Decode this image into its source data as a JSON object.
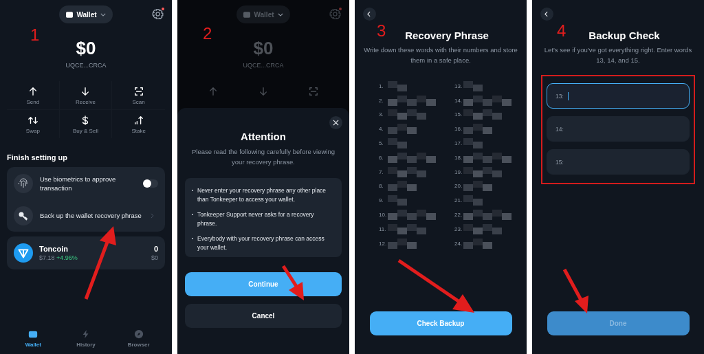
{
  "screen_1": {
    "step": "1",
    "wallet_switcher": {
      "label": "Wallet"
    },
    "settings": {
      "notification": true
    },
    "balance": "$0",
    "address": "UQCE...CRCA",
    "actions": [
      {
        "kind": "send",
        "label": "Send"
      },
      {
        "kind": "receive",
        "label": "Receive"
      },
      {
        "kind": "scan",
        "label": "Scan"
      },
      {
        "kind": "swap",
        "label": "Swap"
      },
      {
        "kind": "buy",
        "label": "Buy & Sell"
      },
      {
        "kind": "stake",
        "label": "Stake"
      }
    ],
    "section_title": "Finish setting up",
    "setup_items": [
      {
        "kind": "toggle",
        "label": "Use biometrics to approve transaction",
        "on": false
      },
      {
        "kind": "link",
        "label": "Back up the wallet recovery phrase"
      }
    ],
    "token": {
      "name": "Toncoin",
      "price": "$7.18",
      "change": "+4.96%",
      "amount": "0",
      "value": "$0"
    },
    "tabs": [
      {
        "kind": "wallet",
        "label": "Wallet",
        "selected": true
      },
      {
        "kind": "history",
        "label": "History",
        "selected": false
      },
      {
        "kind": "browser",
        "label": "Browser",
        "selected": false
      }
    ]
  },
  "screen_2": {
    "step": "2",
    "background": {
      "wallet_switcher": "Wallet",
      "settings": {
        "notification": true
      },
      "balance": "$0",
      "address": "UQCE...CRCA",
      "actions": [
        {
          "kind": "send"
        },
        {
          "kind": "receive"
        },
        {
          "kind": "scan"
        }
      ]
    },
    "dialog": {
      "title": "Attention",
      "subtitle": "Please read the following carefully before viewing your recovery phrase.",
      "bullets": [
        "Never enter your recovery phrase any other place than Tonkeeper to access your wallet.",
        "Tonkeeper Support never asks for a recovery phrase.",
        "Everybody with your recovery phrase can access your wallet."
      ],
      "buttons": [
        {
          "kind": "primary",
          "label": "Continue"
        },
        {
          "kind": "secondary",
          "label": "Cancel"
        }
      ]
    }
  },
  "screen_3": {
    "step": "3",
    "title": "Recovery Phrase",
    "subtitle": "Write down these words with their numbers and store them in a safe place.",
    "numbers": [
      "1.",
      "2.",
      "3.",
      "4.",
      "5.",
      "6.",
      "7.",
      "8.",
      "9.",
      "10.",
      "11.",
      "12.",
      "13.",
      "14.",
      "15.",
      "16.",
      "17.",
      "18.",
      "19.",
      "20.",
      "21.",
      "22.",
      "23.",
      "24."
    ],
    "button": "Check Backup"
  },
  "screen_4": {
    "step": "4",
    "title": "Backup Check",
    "subtitle": "Let's see if you've got everything right. Enter words 13, 14, and 15.",
    "fields": [
      {
        "label": "13:",
        "focused": true
      },
      {
        "label": "14:",
        "focused": false
      },
      {
        "label": "15:",
        "focused": false
      }
    ],
    "button": {
      "label": "Done",
      "disabled": true
    }
  }
}
